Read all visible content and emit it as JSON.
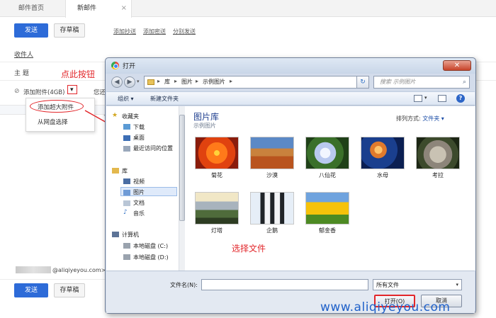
{
  "tabs": [
    {
      "label": "邮件首页"
    },
    {
      "label": "新邮件",
      "close": "×"
    }
  ],
  "toolbar": {
    "send": "发送",
    "draft": "存草稿",
    "links": [
      "添加抄送",
      "添加密送",
      "分别发送"
    ]
  },
  "compose": {
    "recipient_label": "收件人",
    "subject_label": "主  题",
    "attach_label": "添加附件(4GB)",
    "attach_dropdown": "▾",
    "hint_partial": "您还",
    "partial_text": "14p",
    "menu_items": [
      "添加超大附件",
      "从网盘选择"
    ],
    "sender_email": "@aliqiyeyou.com>",
    "send_bottom": "发送",
    "draft_bottom": "存草稿"
  },
  "annotations": {
    "click_here": "点此按钮",
    "select_file": "选择文件"
  },
  "dialog": {
    "title": "打开",
    "close": "✕",
    "breadcrumb": [
      "库",
      "图片",
      "示例图片"
    ],
    "search_placeholder": "搜索 示例图片",
    "organize": "组织 ▾",
    "new_folder": "新建文件夹",
    "help": "?",
    "nav": {
      "favorites": "收藏夹",
      "downloads": "下载",
      "desktop": "桌面",
      "recent": "最近访问的位置",
      "libraries": "库",
      "videos": "视频",
      "pictures": "图片",
      "documents": "文档",
      "music": "音乐",
      "computer": "计算机",
      "drive_c": "本地磁盘 (C:)",
      "drive_d": "本地磁盘 (D:)"
    },
    "library_title": "图片库",
    "library_sub": "示例图片",
    "arrange_label": "排列方式:",
    "arrange_value": "文件夹 ▾",
    "files": [
      "菊花",
      "沙漠",
      "八仙花",
      "水母",
      "考拉",
      "灯塔",
      "企鹅",
      "郁金香"
    ],
    "filename_label": "文件名(N):",
    "filename_value": "",
    "filetype": "所有文件",
    "open_button": "打开(O)",
    "cancel_button": "取消"
  },
  "watermark": "www.aliqiyeyou.com",
  "colors": {
    "accent": "#2d6bd8",
    "annotation": "#e2262a",
    "watermark": "#2061c9"
  }
}
